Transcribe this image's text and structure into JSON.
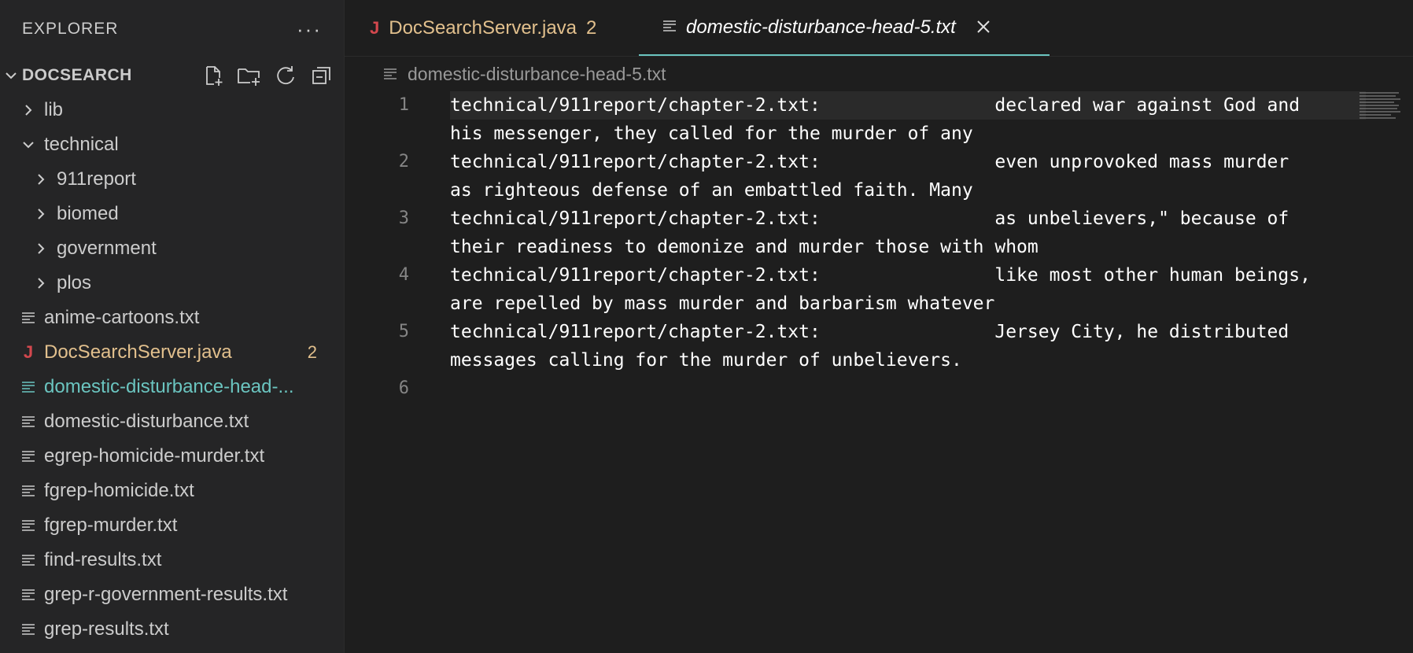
{
  "sidebar": {
    "title": "EXPLORER",
    "more": "···",
    "workspace": "DOCSEARCH",
    "tree": [
      {
        "label": "lib",
        "type": "folder",
        "expanded": false,
        "depth": 0
      },
      {
        "label": "technical",
        "type": "folder",
        "expanded": true,
        "depth": 0
      },
      {
        "label": "911report",
        "type": "folder",
        "expanded": false,
        "depth": 1
      },
      {
        "label": "biomed",
        "type": "folder",
        "expanded": false,
        "depth": 1
      },
      {
        "label": "government",
        "type": "folder",
        "expanded": false,
        "depth": 1
      },
      {
        "label": "plos",
        "type": "folder",
        "expanded": false,
        "depth": 1
      },
      {
        "label": "anime-cartoons.txt",
        "type": "text"
      },
      {
        "label": "DocSearchServer.java",
        "type": "java",
        "badge": "2"
      },
      {
        "label": "domestic-disturbance-head-...",
        "type": "text",
        "active": true
      },
      {
        "label": "domestic-disturbance.txt",
        "type": "text"
      },
      {
        "label": "egrep-homicide-murder.txt",
        "type": "text"
      },
      {
        "label": "fgrep-homicide.txt",
        "type": "text"
      },
      {
        "label": "fgrep-murder.txt",
        "type": "text"
      },
      {
        "label": "find-results.txt",
        "type": "text"
      },
      {
        "label": "grep-r-government-results.txt",
        "type": "text"
      },
      {
        "label": "grep-results.txt",
        "type": "text"
      }
    ]
  },
  "tabs": [
    {
      "label": "DocSearchServer.java",
      "badge": "2"
    },
    {
      "label": "domestic-disturbance-head-5.txt"
    }
  ],
  "breadcrumb": "domestic-disturbance-head-5.txt",
  "lines": [
    {
      "num": "1",
      "text": "technical/911report/chapter-2.txt:                declared war against God and",
      "cont": "his messenger, they called for the murder of any"
    },
    {
      "num": "2",
      "text": "technical/911report/chapter-2.txt:                even unprovoked mass murder",
      "cont": "as righteous defense of an embattled faith. Many"
    },
    {
      "num": "3",
      "text": "technical/911report/chapter-2.txt:                as unbelievers,\" because of",
      "cont": "their readiness to demonize and murder those with whom"
    },
    {
      "num": "4",
      "text": "technical/911report/chapter-2.txt:                like most other human beings,",
      "cont": "are repelled by mass murder and barbarism whatever"
    },
    {
      "num": "5",
      "text": "technical/911report/chapter-2.txt:                Jersey City, he distributed",
      "cont": "messages calling for the murder of unbelievers."
    },
    {
      "num": "6",
      "text": "",
      "cont": ""
    }
  ],
  "colors": {
    "accent": "#6bc5c0",
    "java": "#d3484e",
    "modified": "#e2c08d"
  }
}
